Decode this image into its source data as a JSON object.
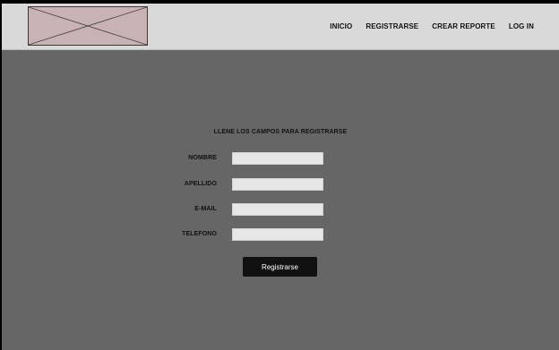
{
  "nav": {
    "items": [
      {
        "label": "INICIO"
      },
      {
        "label": "REGISTRARSE"
      },
      {
        "label": "CREAR REPORTE"
      },
      {
        "label": "LOG IN"
      }
    ]
  },
  "form": {
    "title": "LLENE LOS CAMPOS PARA REGISTRARSE",
    "fields": [
      {
        "label": "NOMBRE",
        "value": ""
      },
      {
        "label": "APELLIDO",
        "value": ""
      },
      {
        "label": "E-MAIL",
        "value": ""
      },
      {
        "label": "TELEFONO",
        "value": ""
      }
    ],
    "submit_label": "Registrarse"
  },
  "colors": {
    "header_bg": "#d9d9d9",
    "page_bg": "#666666",
    "logo_placeholder": "#c9b2b4",
    "input_bg": "#e6e6e6",
    "button_bg": "#111111"
  },
  "icons": {
    "logo": "image-placeholder-icon"
  }
}
